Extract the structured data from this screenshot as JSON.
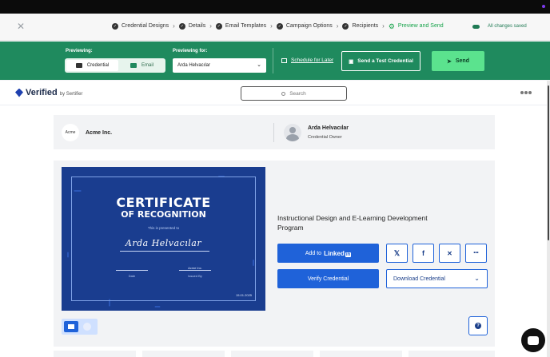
{
  "steps": [
    {
      "label": "Credential Designs",
      "state": "done"
    },
    {
      "label": "Details",
      "state": "done"
    },
    {
      "label": "Email Templates",
      "state": "done"
    },
    {
      "label": "Campaign Options",
      "state": "done"
    },
    {
      "label": "Recipients",
      "state": "done"
    },
    {
      "label": "Preview and Send",
      "state": "active"
    }
  ],
  "saved_status": "All changes saved",
  "toolbar": {
    "previewing_label": "Previewing:",
    "credential_option": "Credential",
    "email_option": "Email",
    "previewing_for_label": "Previewing for:",
    "previewing_for_value": "Arda Helvacılar",
    "schedule_label": "Schedule for Later",
    "test_label": "Send a Test Credential",
    "send_label": "Send"
  },
  "verified_header": {
    "brand": "Verified",
    "brand_suffix": "by Sertifier",
    "search_placeholder": "Search"
  },
  "issuer": {
    "logo_text": "Acme",
    "name": "Acme Inc."
  },
  "owner": {
    "name": "Arda Helvacılar",
    "role": "Credential Owner"
  },
  "certificate": {
    "title_line1": "CERTIFICATE",
    "title_line2": "OF RECOGNITION",
    "presented": "This is presented to",
    "recipient": "Arda Helvacılar",
    "issuer_text": "Acme Inc.",
    "date_label": "Date",
    "issued_by_label": "Issued By",
    "date_value": "15.01.2025"
  },
  "credential": {
    "title": "Instructional Design and E-Learning Development Program",
    "linkedin_prefix": "Add to",
    "linkedin_brand": "Linked",
    "linkedin_in": "in",
    "verify_label": "Verify Credential",
    "download_label": "Download Credential",
    "social": [
      {
        "icon": "x-icon",
        "glyph": "𝕏"
      },
      {
        "icon": "facebook-icon",
        "glyph": "f"
      },
      {
        "icon": "xing-icon",
        "glyph": "✕"
      },
      {
        "icon": "more-icon",
        "glyph": "•••"
      }
    ]
  },
  "colors": {
    "brand_green": "#1f8a5e",
    "send_green": "#5be38e",
    "primary_blue": "#1f62d9",
    "certificate_blue": "#1a3d8f"
  }
}
